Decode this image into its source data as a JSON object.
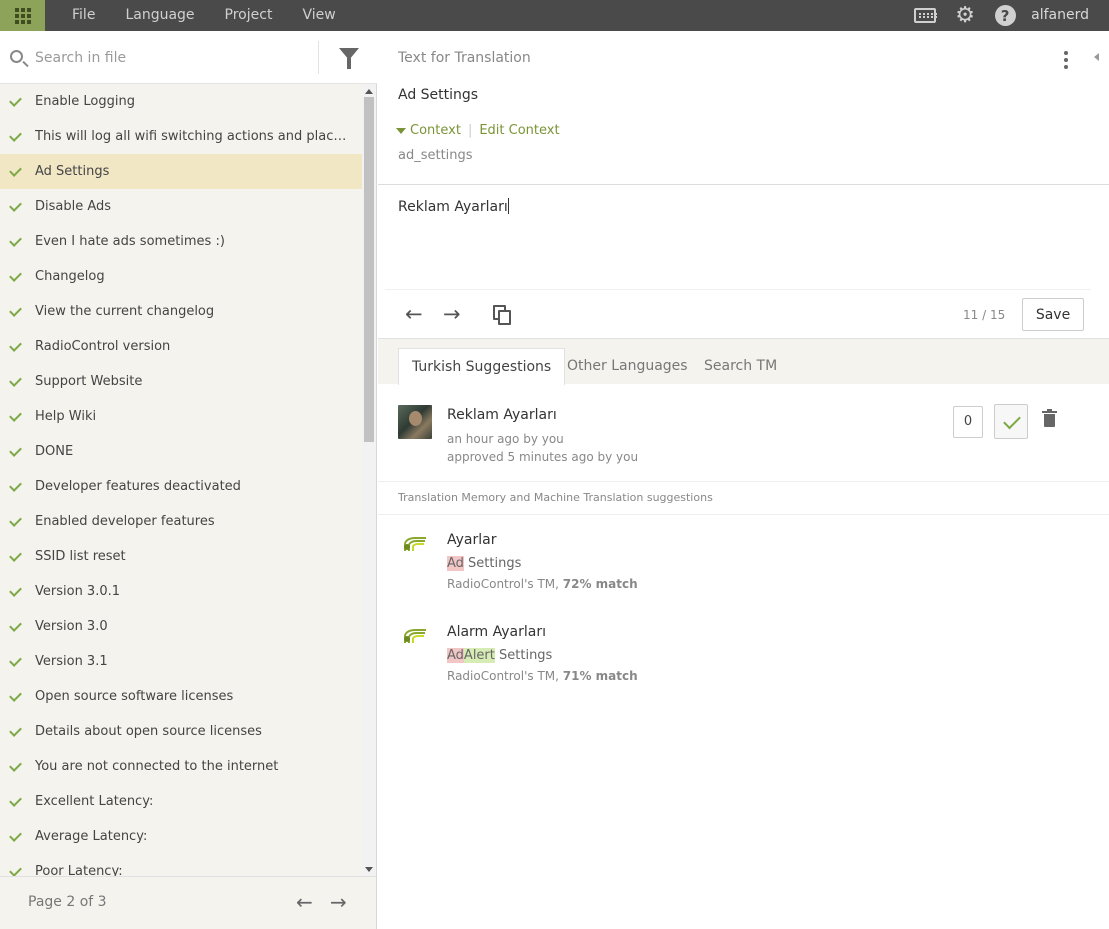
{
  "topbar": {
    "menu": [
      "File",
      "Language",
      "Project",
      "View"
    ],
    "username": "alfanerd"
  },
  "sidebar": {
    "search_placeholder": "Search in file",
    "items": [
      {
        "label": "Enable Logging",
        "status": "translated"
      },
      {
        "label": "This will log all wifi switching actions and place it i...",
        "status": "translated"
      },
      {
        "label": "Ad Settings",
        "status": "translated",
        "selected": true
      },
      {
        "label": "Disable Ads",
        "status": "translated"
      },
      {
        "label": "Even I hate ads sometimes :)",
        "status": "translated"
      },
      {
        "label": "Changelog",
        "status": "translated"
      },
      {
        "label": "View the current changelog",
        "status": "translated"
      },
      {
        "label": "RadioControl version",
        "status": "translated"
      },
      {
        "label": "Support Website",
        "status": "translated"
      },
      {
        "label": "Help Wiki",
        "status": "translated"
      },
      {
        "label": "DONE",
        "status": "translated"
      },
      {
        "label": "Developer features deactivated",
        "status": "translated"
      },
      {
        "label": "Enabled developer features",
        "status": "translated"
      },
      {
        "label": "SSID list reset",
        "status": "translated"
      },
      {
        "label": "Version 3.0.1",
        "status": "translated"
      },
      {
        "label": "Version 3.0",
        "status": "translated"
      },
      {
        "label": "Version 3.1",
        "status": "translated"
      },
      {
        "label": "Open source software licenses",
        "status": "translated"
      },
      {
        "label": "Details about open source licenses",
        "status": "translated"
      },
      {
        "label": "You are not connected to the internet",
        "status": "translated"
      },
      {
        "label": "Excellent Latency:",
        "status": "translated"
      },
      {
        "label": "Average Latency:",
        "status": "translated"
      },
      {
        "label": "Poor Latency:",
        "status": "translated"
      }
    ],
    "page_info": "Page 2 of 3"
  },
  "editor": {
    "source_title": "Text for Translation",
    "source_text": "Ad Settings",
    "context_toggle": "Context",
    "edit_context": "Edit Context",
    "context_key": "ad_settings",
    "translation_value": "Reklam Ayarları",
    "counter": "11 / 15",
    "save_label": "Save"
  },
  "tabs": [
    "Turkish Suggestions",
    "Other Languages",
    "Search TM"
  ],
  "suggestion": {
    "text": "Reklam Ayarları",
    "created": "an hour ago by you",
    "approved": "approved 5 minutes ago by you",
    "votes": "0"
  },
  "tm": {
    "header": "Translation Memory and Machine Translation suggestions",
    "items": [
      {
        "target": "Ayarlar",
        "source_parts": [
          {
            "text": "Ad",
            "type": "del"
          },
          {
            "text": " Settings",
            "type": "plain"
          }
        ],
        "meta_prefix": "RadioControl's TM, ",
        "meta_match": "72% match"
      },
      {
        "target": "Alarm Ayarları",
        "source_parts": [
          {
            "text": "Ad",
            "type": "del"
          },
          {
            "text": "Alert",
            "type": "ins"
          },
          {
            "text": " Settings",
            "type": "plain"
          }
        ],
        "meta_prefix": "RadioControl's TM, ",
        "meta_match": "71% match"
      }
    ]
  },
  "colors": {
    "topbar_bg": "#4a4a4a",
    "apps_bg": "#8da35a",
    "accent_green": "#7a9436",
    "selected_row": "#f1e7c5",
    "diff_deleted": "#f3c6c6",
    "diff_inserted": "#d7ecb4"
  },
  "icons": [
    "apps-grid-icon",
    "keyboard-icon",
    "gear-icon",
    "help-icon",
    "search-icon",
    "filter-icon",
    "check-icon",
    "arrow-left-icon",
    "arrow-right-icon",
    "copy-original-icon",
    "kebab-menu-icon",
    "trash-icon",
    "tm-logo-icon"
  ]
}
